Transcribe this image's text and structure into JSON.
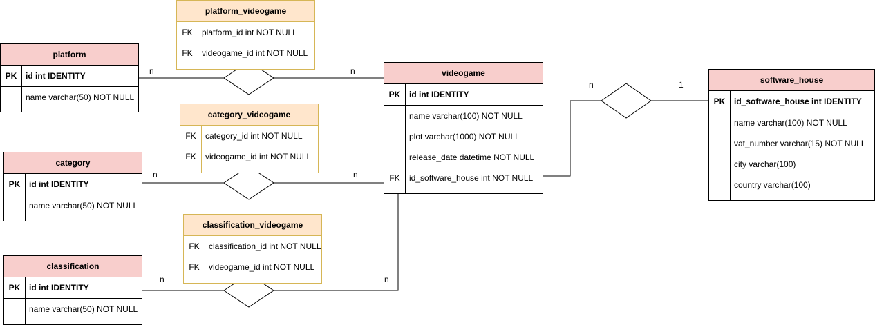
{
  "entities": {
    "platform": {
      "title": "platform",
      "rows": [
        {
          "key": "PK",
          "text": "id int IDENTITY"
        },
        {
          "key": "",
          "text": "name varchar(50) NOT NULL"
        }
      ]
    },
    "category": {
      "title": "category",
      "rows": [
        {
          "key": "PK",
          "text": "id int IDENTITY"
        },
        {
          "key": "",
          "text": "name varchar(50) NOT NULL"
        }
      ]
    },
    "classification": {
      "title": "classification",
      "rows": [
        {
          "key": "PK",
          "text": "id int IDENTITY"
        },
        {
          "key": "",
          "text": "name varchar(50) NOT NULL"
        }
      ]
    },
    "videogame": {
      "title": "videogame",
      "rows": [
        {
          "key": "PK",
          "text": "id int IDENTITY"
        },
        {
          "key": "",
          "text": "name varchar(100) NOT NULL"
        },
        {
          "key": "",
          "text": "plot  varchar(1000) NOT NULL"
        },
        {
          "key": "",
          "text": "release_date datetime NOT NULL"
        },
        {
          "key": "FK",
          "text": "id_software_house int NOT NULL"
        }
      ]
    },
    "software_house": {
      "title": "software_house",
      "rows": [
        {
          "key": "PK",
          "text": "id_software_house int IDENTITY"
        },
        {
          "key": "",
          "text": "name varchar(100) NOT NULL"
        },
        {
          "key": "",
          "text": "vat_number varchar(15) NOT NULL"
        },
        {
          "key": "",
          "text": "city varchar(100)"
        },
        {
          "key": "",
          "text": "country varchar(100)"
        }
      ]
    }
  },
  "associations": {
    "platform_videogame": {
      "title": "platform_videogame",
      "rows": [
        {
          "key": "FK",
          "text": "platform_id int NOT NULL"
        },
        {
          "key": "FK",
          "text": "videogame_id int NOT NULL"
        }
      ]
    },
    "category_videogame": {
      "title": "category_videogame",
      "rows": [
        {
          "key": "FK",
          "text": "category_id int NOT NULL"
        },
        {
          "key": "FK",
          "text": "videogame_id int NOT NULL"
        }
      ]
    },
    "classification_videogame": {
      "title": "classification_videogame",
      "rows": [
        {
          "key": "FK",
          "text": "classification_id int NOT NULL"
        },
        {
          "key": "FK",
          "text": "videogame_id int NOT NULL"
        }
      ]
    }
  },
  "cardinalities": {
    "platform_left": "n",
    "platform_right": "n",
    "category_left": "n",
    "category_right": "n",
    "classification_left": "n",
    "classification_right": "n",
    "software_house_left": "n",
    "software_house_right": "1"
  },
  "colors": {
    "entity_header": "#f8cecc",
    "assoc_header": "#ffe6cc",
    "assoc_border": "#d6b656"
  }
}
